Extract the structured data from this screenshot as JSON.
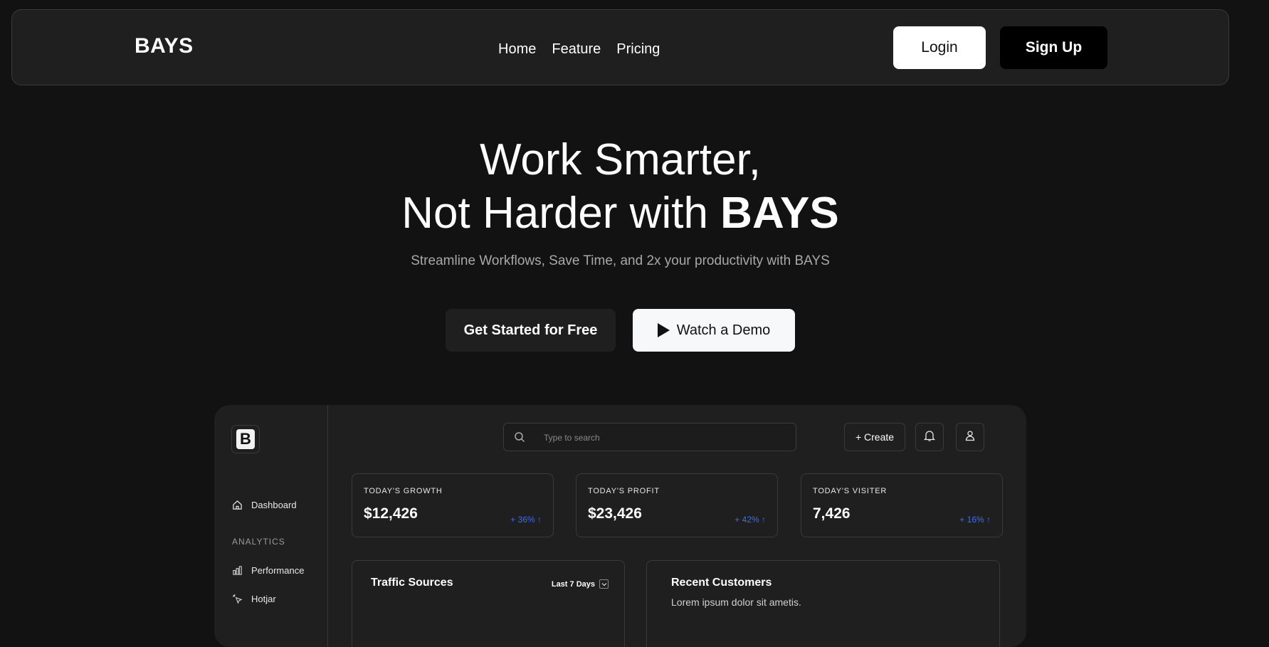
{
  "nav": {
    "logo": "BAYS",
    "links": [
      "Home",
      "Feature",
      "Pricing"
    ],
    "login_label": "Login",
    "signup_label": "Sign Up"
  },
  "hero": {
    "title_line1": "Work Smarter,",
    "title_line2_prefix": "Not Harder with ",
    "title_line2_brand": "BAYS",
    "subtitle": "Streamline Workflows, Save Time, and 2x your productivity with BAYS",
    "cta_primary": "Get Started for Free",
    "cta_secondary": "Watch a Demo"
  },
  "dashboard": {
    "logo_letter": "B",
    "sidebar": {
      "dashboard_label": "Dashboard",
      "analytics_heading": "ANALYTICS",
      "performance_label": "Performance",
      "hotjar_label": "Hotjar"
    },
    "search_placeholder": "Type to search",
    "create_label": "+ Create",
    "stats": [
      {
        "label": "TODAY'S GROWTH",
        "value": "$12,426",
        "change": "+ 36% ↑"
      },
      {
        "label": "TODAY'S PROFIT",
        "value": "$23,426",
        "change": "+ 42% ↑"
      },
      {
        "label": "TODAY'S VISITER",
        "value": "7,426",
        "change": "+ 16% ↑"
      }
    ],
    "traffic": {
      "title": "Traffic Sources",
      "range": "Last 7 Days"
    },
    "customers": {
      "title": "Recent Customers",
      "subtitle": "Lorem ipsum dolor sit ametis."
    },
    "accent_color": "#3b6cf5"
  }
}
